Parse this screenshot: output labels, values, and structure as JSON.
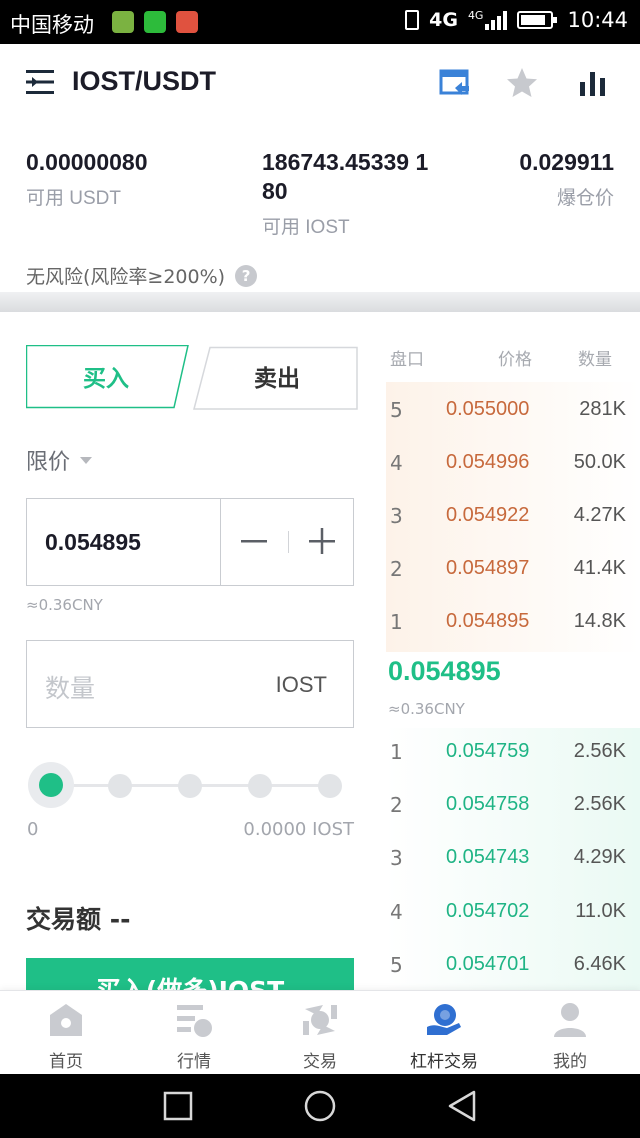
{
  "status_bar": {
    "carrier": "中国移动",
    "network": "4G",
    "network_small": "4G",
    "time": "10:44"
  },
  "header": {
    "title": "IOST/USDT",
    "icons": [
      "transfer-icon",
      "star-icon",
      "chart-icon"
    ]
  },
  "balances": [
    {
      "value": "0.00000080",
      "label": "可用 USDT"
    },
    {
      "value": "186743.45339 180",
      "label": "可用 IOST"
    },
    {
      "value": "0.029911",
      "label": "爆仓价"
    }
  ],
  "risk": {
    "text": "无风险(风险率≥200%)",
    "help_icon": "?"
  },
  "order_form": {
    "buy_tab": "买入",
    "sell_tab": "卖出",
    "order_type": "限价",
    "price": "0.054895",
    "price_cny": "≈0.36CNY",
    "quantity_placeholder": "数量",
    "quantity_unit": "IOST",
    "slider_min": "0",
    "slider_max": "0.0000 IOST",
    "slider_fraction": 0,
    "turnover_label": "交易额 --",
    "submit_label": "买入(做多)IOST"
  },
  "order_book": {
    "headers": {
      "level": "盘口",
      "price": "价格",
      "quantity": "数量"
    },
    "asks": [
      {
        "level": "5",
        "price": "0.055000",
        "qty": "281K"
      },
      {
        "level": "4",
        "price": "0.054996",
        "qty": "50.0K"
      },
      {
        "level": "3",
        "price": "0.054922",
        "qty": "4.27K"
      },
      {
        "level": "2",
        "price": "0.054897",
        "qty": "41.4K"
      },
      {
        "level": "1",
        "price": "0.054895",
        "qty": "14.8K"
      }
    ],
    "last_price": "0.054895",
    "last_price_cny": "≈0.36CNY",
    "bids": [
      {
        "level": "1",
        "price": "0.054759",
        "qty": "2.56K"
      },
      {
        "level": "2",
        "price": "0.054758",
        "qty": "2.56K"
      },
      {
        "level": "3",
        "price": "0.054743",
        "qty": "4.29K"
      },
      {
        "level": "4",
        "price": "0.054702",
        "qty": "11.0K"
      },
      {
        "level": "5",
        "price": "0.054701",
        "qty": "6.46K"
      }
    ]
  },
  "bottom_nav": {
    "items": [
      {
        "label": "首页",
        "icon": "home-icon"
      },
      {
        "label": "行情",
        "icon": "market-icon"
      },
      {
        "label": "交易",
        "icon": "trade-icon"
      },
      {
        "label": "杠杆交易",
        "icon": "margin-trade-icon",
        "active": true
      },
      {
        "label": "我的",
        "icon": "profile-icon"
      }
    ]
  },
  "colors": {
    "accent_green": "#1fbf87",
    "ask_orange": "#c7693c",
    "active_nav_blue": "#2f6fd1"
  }
}
